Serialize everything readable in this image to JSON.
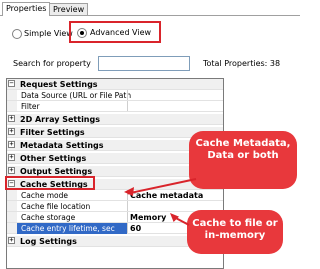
{
  "tabs": [
    {
      "label": "Properties",
      "active": true
    },
    {
      "label": "Preview",
      "active": false
    }
  ],
  "view_options": {
    "simple_label": "Simple View",
    "advanced_label": "Advanced View",
    "selected": "Advanced View"
  },
  "search": {
    "label": "Search for property",
    "value": "",
    "total_label": "Total Properties: 38"
  },
  "grid": {
    "rows": [
      {
        "type": "category",
        "expanded": true,
        "label": "Request Settings"
      },
      {
        "type": "property",
        "name": "Data Source (URL or File Path",
        "value": ""
      },
      {
        "type": "property",
        "name": "Filter",
        "value": ""
      },
      {
        "type": "category",
        "expanded": false,
        "label": "2D Array Settings"
      },
      {
        "type": "category",
        "expanded": false,
        "label": "Filter Settings"
      },
      {
        "type": "category",
        "expanded": false,
        "label": "Metadata Settings"
      },
      {
        "type": "category",
        "expanded": false,
        "label": "Other Settings"
      },
      {
        "type": "category",
        "expanded": false,
        "label": "Output Settings"
      },
      {
        "type": "category",
        "expanded": true,
        "label": "Cache Settings"
      },
      {
        "type": "property",
        "name": "Cache mode",
        "value": "Cache metadata"
      },
      {
        "type": "property",
        "name": "Cache file location",
        "value": ""
      },
      {
        "type": "property",
        "name": "Cache storage",
        "value": "Memory"
      },
      {
        "type": "property",
        "name": "Cache entry lifetime, sec",
        "value": "60",
        "selected": true
      },
      {
        "type": "category",
        "expanded": false,
        "label": "Log Settings"
      }
    ]
  },
  "callouts": {
    "metadata": "Cache Metadata, Data or both",
    "storage": "Cache to file or in-memory"
  },
  "colors": {
    "highlight_red": "#d9242b",
    "callout_fill": "#e8383c",
    "selection_blue": "#3169c6"
  }
}
